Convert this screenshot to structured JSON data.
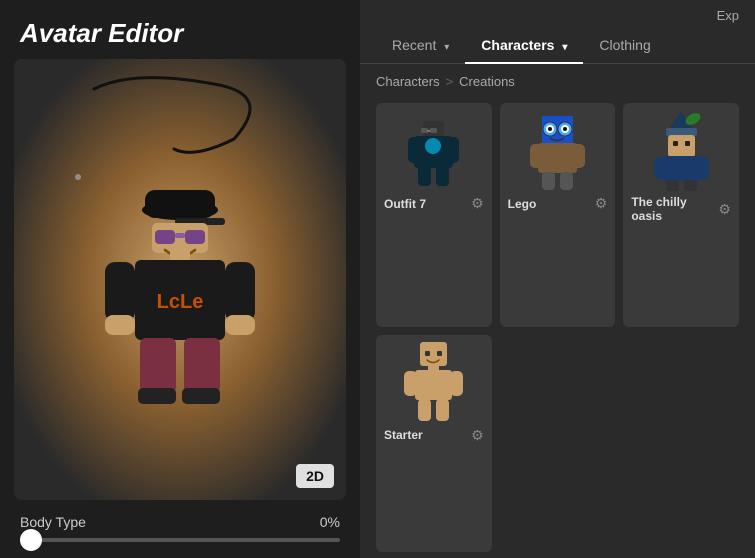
{
  "app": {
    "title": "Avatar Editor"
  },
  "topbar": {
    "explore_label": "Exp"
  },
  "tabs": [
    {
      "id": "recent",
      "label": "Recent",
      "active": false,
      "has_chevron": true
    },
    {
      "id": "characters",
      "label": "Characters",
      "active": true,
      "has_chevron": true
    },
    {
      "id": "clothing",
      "label": "Clothing",
      "active": false,
      "has_chevron": false
    }
  ],
  "breadcrumb": {
    "parent": "Characters",
    "separator": ">",
    "current": "Creations"
  },
  "items": [
    {
      "id": "outfit7",
      "name": "Outfit 7",
      "has_gear": true,
      "color": "#222"
    },
    {
      "id": "lego",
      "name": "Lego",
      "has_gear": true,
      "color": "#7a5c3a"
    },
    {
      "id": "chilly",
      "name": "The chilly oasis",
      "has_gear": true,
      "color": "#1a3a5c"
    },
    {
      "id": "starter",
      "name": "Starter",
      "has_gear": true,
      "color": "#c9a06a"
    }
  ],
  "body_type": {
    "label": "Body Type",
    "percent": "0%",
    "value": 0
  },
  "btn_2d": "2D"
}
